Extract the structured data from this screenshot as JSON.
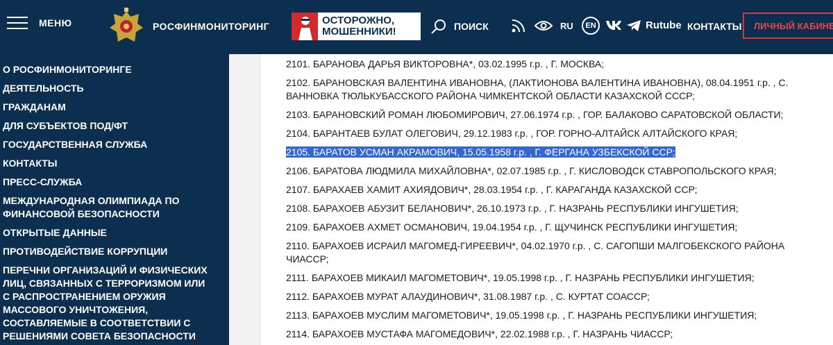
{
  "header": {
    "menu_label": "МЕНЮ",
    "brand": "РОСФИНМОНИТОРИНГ",
    "banner_line1": "ОСТОРОЖНО,",
    "banner_line2": "МОШЕННИКИ!",
    "search_label": "ПОИСК",
    "lang_ru": "RU",
    "lang_en": "EN",
    "rutube_label": "Rutube",
    "contacts_label": "КОНТАКТЫ",
    "cabinet_label": "ЛИЧНЫЙ КАБИНЕТ"
  },
  "sidebar": {
    "items": [
      {
        "label": "О РОСФИНМОНИТОРИНГЕ"
      },
      {
        "label": "ДЕЯТЕЛЬНОСТЬ"
      },
      {
        "label": "ГРАЖДАНАМ"
      },
      {
        "label": "ДЛЯ СУБЪЕКТОВ ПОД/ФТ"
      },
      {
        "label": "ГОСУДАРСТВЕННАЯ СЛУЖБА"
      },
      {
        "label": "КОНТАКТЫ"
      },
      {
        "label": "ПРЕСС-СЛУЖБА"
      },
      {
        "label": "МЕЖДУНАРОДНАЯ ОЛИМПИАДА ПО ФИНАНСОВОЙ БЕЗОПАСНОСТИ"
      },
      {
        "label": "ОТКРЫТЫЕ ДАННЫЕ"
      },
      {
        "label": "ПРОТИВОДЕЙСТВИЕ КОРРУПЦИИ"
      },
      {
        "label": "ПЕРЕЧНИ ОРГАНИЗАЦИЙ И ФИЗИЧЕСКИХ ЛИЦ, СВЯЗАННЫХ С ТЕРРОРИЗМОМ ИЛИ С РАСПРОСТРАНЕНИЕМ ОРУЖИЯ МАССОВОГО УНИЧТОЖЕНИЯ, СОСТАВЛЯЕМЫЕ В СООТВЕТСТВИИ С РЕШЕНИЯМИ СОВЕТА БЕЗОПАСНОСТИ ООН"
      }
    ]
  },
  "list": {
    "entries": [
      "2101. БАРАНОВА ДАРЬЯ ВИКТОРОВНА*, 03.02.1995 г.р. , Г. МОСКВА;",
      "2102. БАРАНОВСКАЯ ВАЛЕНТИНА ИВАНОВНА, (ЛАКТИОНОВА ВАЛЕНТИНА ИВАНОВНА), 08.04.1951 г.р. , С. ВАННОВКА ТЮЛЬКУБАССКОГО РАЙОНА ЧИМКЕНТСКОЙ ОБЛАСТИ КАЗАХСКОЙ СССР;",
      "2103. БАРАНОВСКИЙ РОМАН ЛЮБОМИРОВИЧ, 27.06.1974 г.р. , ГОР. БАЛАКОВО САРАТОВСКОЙ ОБЛАСТИ;",
      "2104. БАРАНТАЕВ БУЛАТ ОЛЕГОВИЧ, 29.12.1983 г.р. , ГОР. ГОРНО-АЛТАЙСК АЛТАЙСКОГО КРАЯ;",
      "2105. БАРАТОВ УСМАН АКРАМОВИЧ, 15.05.1958 г.р. , Г. ФЕРГАНА УЗБЕКСКОЙ ССР;",
      "2106. БАРАТОВА ЛЮДМИЛА МИХАЙЛОВНА*, 02.07.1985 г.р. , Г. КИСЛОВОДСК СТАВРОПОЛЬСКОГО КРАЯ;",
      "2107. БАРАХАЕВ ХАМИТ АХИЯДОВИЧ*, 28.03.1954 г.р. , Г. КАРАГАНДА КАЗАХСКОЙ ССР;",
      "2108. БАРАХОЕВ АБУЗИТ БЕЛАНОВИЧ*, 26.10.1973 г.р. , Г. НАЗРАНЬ РЕСПУБЛИКИ ИНГУШЕТИЯ;",
      "2109. БАРАХОЕВ АХМЕТ ОСМАНОВИЧ, 19.04.1954 г.р. , Г. ЩУЧИНСК РЕСПУБЛИКИ ИНГУШЕТИЯ;",
      "2110. БАРАХОЕВ ИСРАИЛ МАГОМЕД-ГИРЕЕВИЧ*, 04.02.1970 г.р. , С. САГОПШИ МАЛГОБЕКСКОГО РАЙОНА ЧИАССР;",
      "2111. БАРАХОЕВ МИКАИЛ МАГОМЕТОВИЧ*, 19.05.1998 г.р. , Г. НАЗРАНЬ РЕСПУБЛИКИ ИНГУШЕТИЯ;",
      "2112. БАРАХОЕВ МУРАТ АЛАУДИНОВИЧ*, 31.08.1987 г.р. , С. КУРТАТ СОАССР;",
      "2113. БАРАХОЕВ МУСЛИМ МАГОМЕТОВИЧ*, 19.05.1998 г.р. , Г. НАЗРАНЬ РЕСПУБЛИКИ ИНГУШЕТИЯ;",
      "2114. БАРАХОЕВ МУСТАФА МАГОМЕДОВИЧ*, 22.02.1988 г.р. , Г. НАЗРАНЬ ЧИАССР;"
    ],
    "selected_index": 4
  },
  "colors": {
    "header_bg": "#0d2f4f",
    "accent_red": "#d9363e",
    "selection": "#3367d6"
  },
  "icons": [
    "menu-icon",
    "emblem-icon",
    "search-icon",
    "rss-icon",
    "eye-icon",
    "vk-icon",
    "telegram-icon"
  ]
}
